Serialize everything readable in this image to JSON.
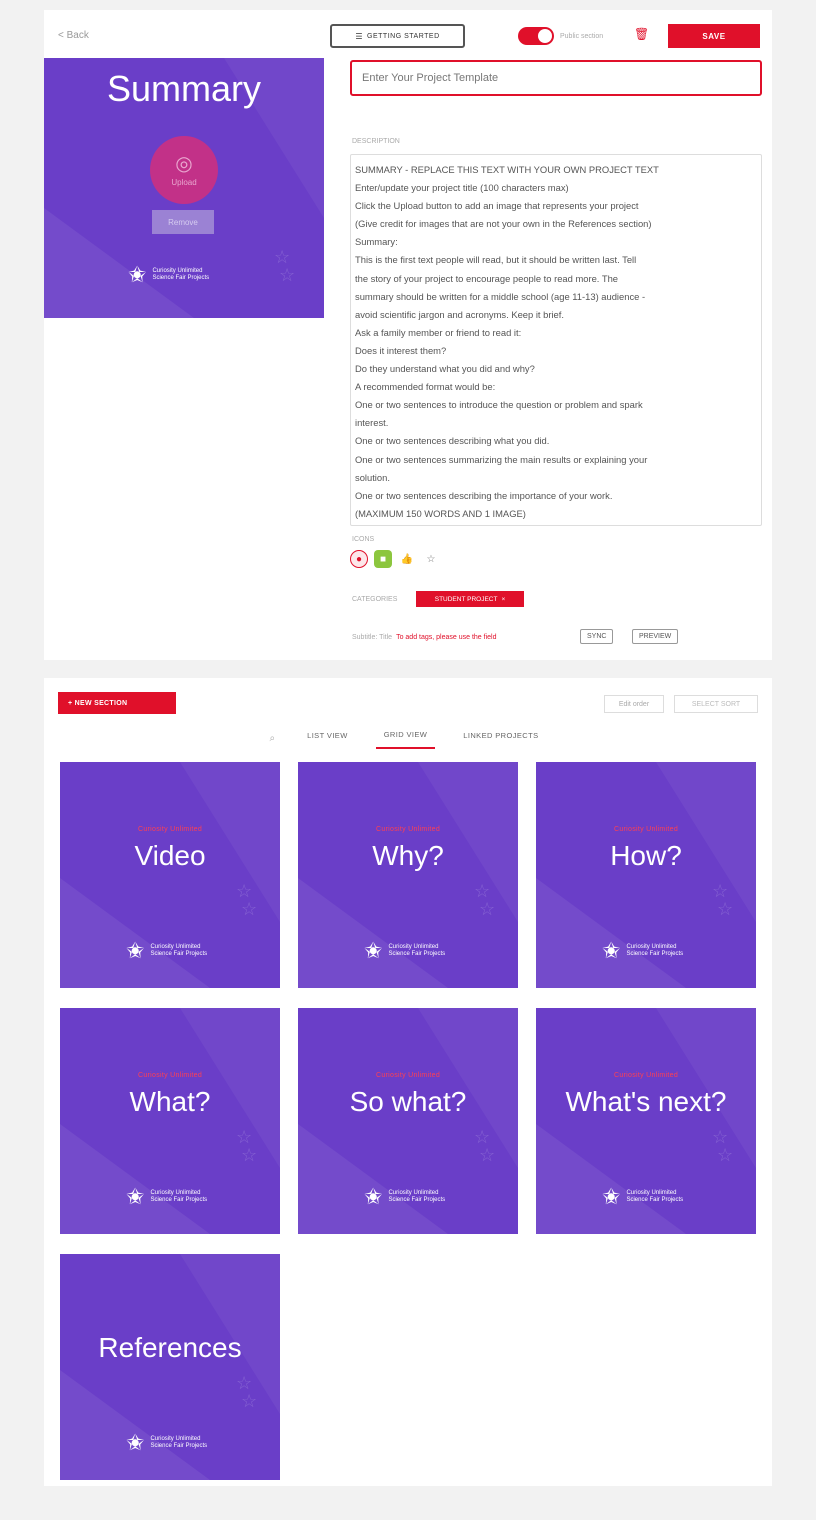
{
  "header": {
    "back_label": "< Back",
    "getting_started_label": "GETTING STARTED",
    "toggle_label": "Public section",
    "toggle_on": true,
    "save_label": "SAVE"
  },
  "cover": {
    "title": "Summary",
    "upload_label": "Upload",
    "remove_label": "Remove",
    "brand_line1": "Curiosity Unlimited",
    "brand_line2": "Science Fair Projects"
  },
  "title_input": {
    "value": "Enter Your Project Template"
  },
  "description": {
    "label": "DESCRIPTION",
    "lines": [
      "SUMMARY - REPLACE THIS TEXT WITH YOUR OWN PROJECT TEXT",
      "Enter/update your project title (100 characters max)",
      "Click the Upload button to add an image that represents your project",
      "(Give credit for images that are not your own in the References section)",
      "Summary:",
      "This is the first text people will read, but it should be written last. Tell",
      "the story of your project to encourage people to read more. The",
      "summary should be written for a middle school (age 11-13) audience -",
      "avoid scientific jargon and acronyms. Keep it brief.",
      "Ask a family member or friend to read it:",
      "Does it interest them?",
      "Do they understand what you did and why?",
      "A recommended format would be:",
      "One or two sentences to introduce the question or problem and spark",
      "interest.",
      "One or two sentences describing what you did.",
      "One or two sentences summarizing the main results or explaining your",
      "solution.",
      "One or two sentences describing the importance of your work.",
      "(MAXIMUM 150 WORDS AND 1 IMAGE)"
    ]
  },
  "icons": {
    "label": "ICONS",
    "items": [
      "record-icon",
      "badge-icon",
      "thumbs-up-icon",
      "star-icon"
    ]
  },
  "category": {
    "label": "CATEGORIES",
    "chip": "STUDENT PROJECT"
  },
  "subtitle": {
    "label": "Subtitle: Title",
    "link": "To add tags, please use the field",
    "btn_a": "SYNC",
    "btn_b": "PREVIEW"
  },
  "sections_toolbar": {
    "new_section_label": "+ NEW SECTION",
    "edit_label": "Edit order",
    "select_label": "SELECT SORT"
  },
  "tabs": [
    {
      "label": "LIST VIEW",
      "active": false
    },
    {
      "label": "GRID VIEW",
      "active": true
    },
    {
      "label": "LINKED PROJECTS",
      "active": false
    }
  ],
  "cards": [
    {
      "kicker": "Curiosity Unlimited",
      "title": "Video"
    },
    {
      "kicker": "Curiosity Unlimited",
      "title": "Why?"
    },
    {
      "kicker": "Curiosity Unlimited",
      "title": "How?"
    },
    {
      "kicker": "Curiosity Unlimited",
      "title": "What?"
    },
    {
      "kicker": "Curiosity Unlimited",
      "title": "So what?"
    },
    {
      "kicker": "Curiosity Unlimited",
      "title": "What's next?"
    },
    {
      "kicker": "",
      "title": "References"
    }
  ],
  "card_brand": {
    "line1": "Curiosity Unlimited",
    "line2": "Science Fair Projects"
  },
  "colors": {
    "accent": "#e0102a",
    "card_bg": "#6a3ec8",
    "page_bg": "#f2f2f2"
  }
}
